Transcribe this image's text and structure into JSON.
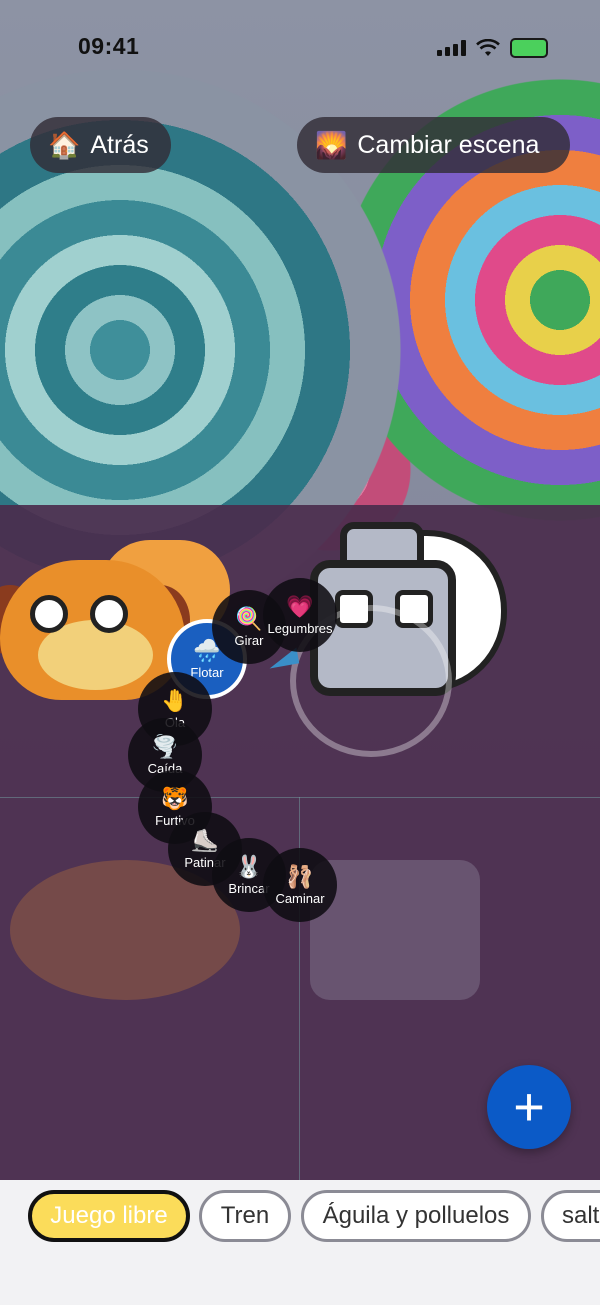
{
  "status_bar": {
    "time": "09:41",
    "icons": [
      "signal-icon",
      "wifi-icon",
      "battery-charging-icon"
    ]
  },
  "top_bar": {
    "back": {
      "icon": "house-icon",
      "emoji": "🏠",
      "label": "Atrás"
    },
    "change_scene": {
      "icon": "scene-image-icon",
      "emoji": "🌄",
      "label": "Cambiar escena"
    }
  },
  "radial_menu": {
    "selected": "Flotar",
    "items": [
      {
        "label": "Flotar",
        "emoji": "🌧️",
        "icon": "cloud-rain-icon"
      },
      {
        "label": "Girar",
        "emoji": "🍭",
        "icon": "lollipop-icon"
      },
      {
        "label": "Legumbres",
        "emoji": "💗",
        "icon": "pink-heart-icon"
      },
      {
        "label": "Ola",
        "emoji": "🤚",
        "icon": "waving-hand-icon"
      },
      {
        "label": "Caída",
        "emoji": "🌪️",
        "icon": "tornado-icon"
      },
      {
        "label": "Furtivo",
        "emoji": "🐯",
        "icon": "tiger-icon"
      },
      {
        "label": "Patinar",
        "emoji": "⛸️",
        "icon": "skate-icon"
      },
      {
        "label": "Brincar",
        "emoji": "🐰",
        "icon": "bunny-icon"
      },
      {
        "label": "Caminar",
        "emoji": "🩰",
        "icon": "ballet-shoes-icon"
      }
    ]
  },
  "fab": {
    "label": "+",
    "icon": "plus-icon"
  },
  "modes": {
    "selected": "Juego libre",
    "items": [
      "Juego libre",
      "Tren",
      "Águila y polluelos",
      "salt"
    ]
  },
  "colors": {
    "accent_blue": "#0b5ac7",
    "selected_chip": "#fbdc5a",
    "menu_node": "#0f0c12"
  }
}
